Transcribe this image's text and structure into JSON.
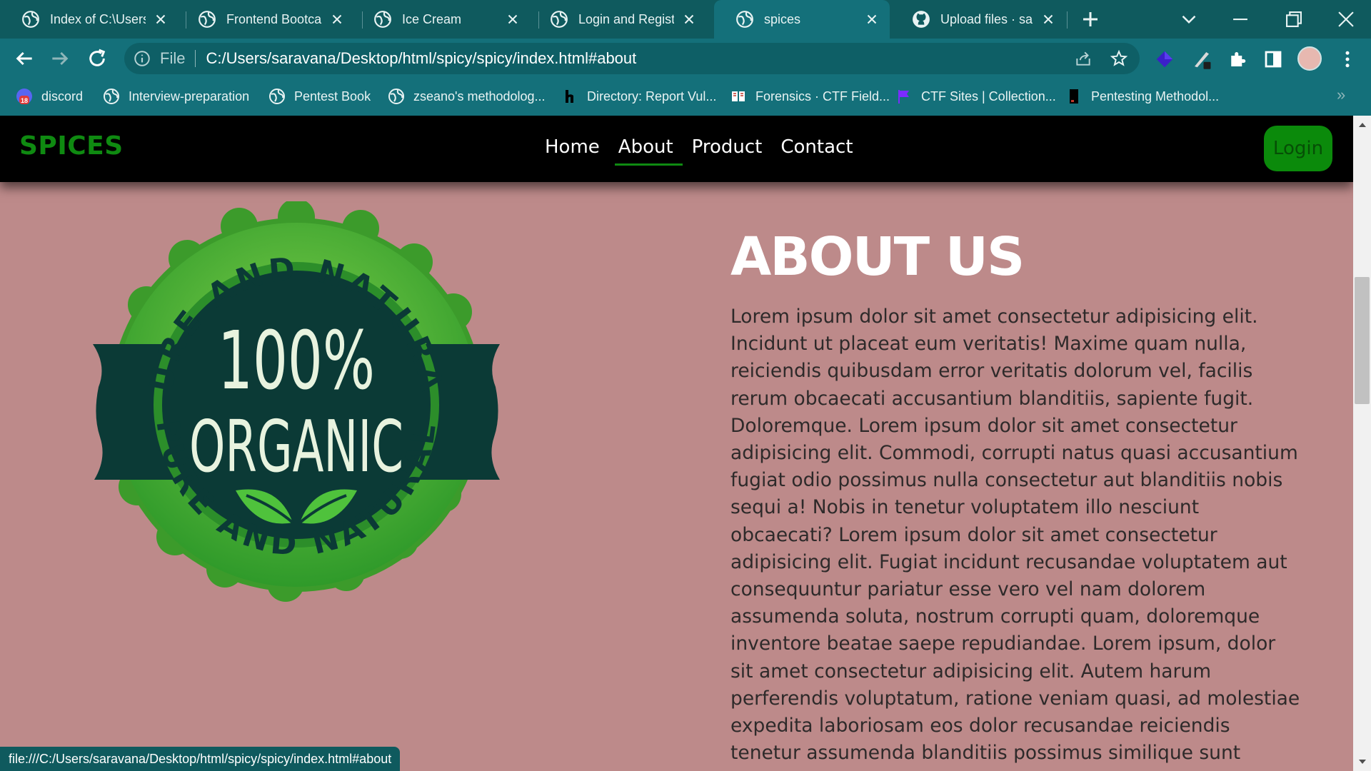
{
  "tabs": [
    {
      "title": "Index of C:\\Users\\saravana",
      "icon": "globe-icon",
      "active": false
    },
    {
      "title": "Frontend Bootcamp",
      "icon": "globe-icon",
      "active": false
    },
    {
      "title": "Ice Cream",
      "icon": "globe-icon",
      "active": false
    },
    {
      "title": "Login and Register",
      "icon": "globe-icon",
      "active": false
    },
    {
      "title": "spices",
      "icon": "globe-icon",
      "active": true
    },
    {
      "title": "Upload files · saravana",
      "icon": "github-icon",
      "active": false
    }
  ],
  "address_bar": {
    "scheme_label": "File",
    "url": "C:/Users/saravana/Desktop/html/spicy/spicy/index.html#about"
  },
  "bookmarks": [
    {
      "label": "discord",
      "icon": "discord-icon",
      "badge": "18"
    },
    {
      "label": "Interview-preparation",
      "icon": "globe-icon"
    },
    {
      "label": "Pentest Book",
      "icon": "globe-icon"
    },
    {
      "label": "zseano's methodolog...",
      "icon": "globe-icon"
    },
    {
      "label": "Directory: Report Vul...",
      "icon": "hackerone-icon"
    },
    {
      "label": "Forensics · CTF Field...",
      "icon": "ctf-field-guide-icon"
    },
    {
      "label": "CTF Sites | Collection...",
      "icon": "flag-icon"
    },
    {
      "label": "Pentesting Methodol...",
      "icon": "book-icon"
    }
  ],
  "site": {
    "brand": "SPICES",
    "nav": [
      "Home",
      "About",
      "Product",
      "Contact"
    ],
    "active_nav": "About",
    "login_label": "Login",
    "badge": {
      "top_arc": "PURE AND NATURAL",
      "percent": "100%",
      "word": "ORGANIC",
      "bottom_arc": "PURE AND NATURAL"
    },
    "about": {
      "title": "ABOUT US",
      "body": "Lorem ipsum dolor sit amet consectetur adipisicing elit. Incidunt ut placeat eum veritatis! Maxime quam nulla, reiciendis quibusdam error veritatis dolorum vel, facilis rerum obcaecati accusantium blanditiis, sapiente fugit. Doloremque. Lorem ipsum dolor sit amet consectetur adipisicing elit. Commodi, corrupti natus quasi accusantium fugiat odio possimus nulla consectetur aut blanditiis nobis sequi a! Nobis in tenetur voluptatem illo nesciunt obcaecati? Lorem ipsum dolor sit amet consectetur adipisicing elit. Fugiat incidunt recusandae voluptatem aut consequuntur pariatur esse vero vel nam dolorem assumenda soluta, nostrum corrupti quam, doloremque inventore beatae saepe repudiandae. Lorem ipsum, dolor sit amet consectetur adipisicing elit. Autem harum perferendis voluptatum, ratione veniam quasi, ad molestiae expedita laboriosam eos dolor recusandae reiciendis tenetur assumenda blanditiis possimus similique sunt quibusdam?"
    }
  },
  "status_bar": {
    "text": "file:///C:/Users/saravana/Desktop/html/spicy/spicy/index.html#about"
  },
  "colors": {
    "chrome": "#0f5a5e",
    "chrome_active": "#14707a",
    "page_background": "#bd8a8a",
    "brand_green": "#0f8a11",
    "navbar": "#000000"
  }
}
